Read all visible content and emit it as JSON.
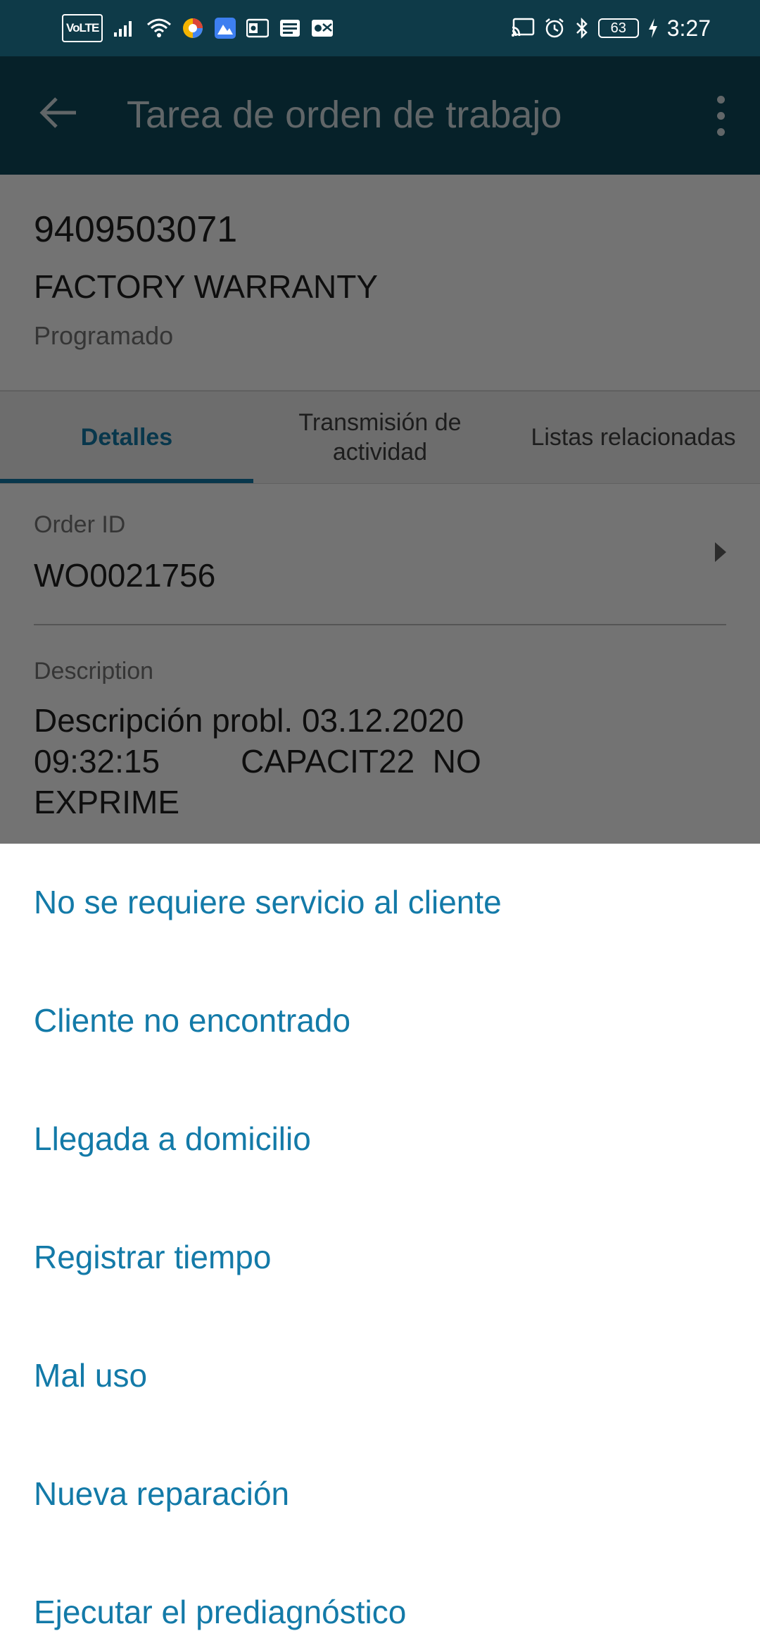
{
  "status_bar": {
    "volte": "VoLTE",
    "battery": "63",
    "time": "3:27",
    "left_icons": [
      "signal-icon",
      "wifi-icon",
      "browser-icon",
      "gallery-icon",
      "outlook-icon",
      "news-icon",
      "outlook-mail-icon"
    ],
    "right_icons": [
      "cast-icon",
      "alarm-icon",
      "bluetooth-icon",
      "battery-icon",
      "charging-icon"
    ]
  },
  "app_bar": {
    "title": "Tarea de orden de trabajo",
    "back_icon": "arrow-back-icon",
    "menu_icon": "more-vert-icon"
  },
  "header": {
    "id": "9409503071",
    "name": "FACTORY WARRANTY",
    "status": "Programado"
  },
  "tabs": [
    {
      "label": "Detalles",
      "active": true
    },
    {
      "label": "Transmisión de actividad",
      "active": false
    },
    {
      "label": "Listas relacionadas",
      "active": false
    }
  ],
  "fields": {
    "order_id_label": "Order ID",
    "order_id_value": "WO0021756",
    "description_label": "Description",
    "description_value": "Descripción probl. 03.12.2020\n09:32:15         CAPACIT22  NO\nEXPRIME"
  },
  "actions": [
    "No se requiere servicio al cliente",
    "Cliente no encontrado",
    "Llegada a domicilio",
    "Registrar tiempo",
    "Mal uso",
    "Nueva reparación",
    "Ejecutar el prediagnóstico"
  ],
  "colors": {
    "app_bar": "#0e4a5c",
    "status_bar": "#0e3a48",
    "accent": "#137aa8"
  }
}
